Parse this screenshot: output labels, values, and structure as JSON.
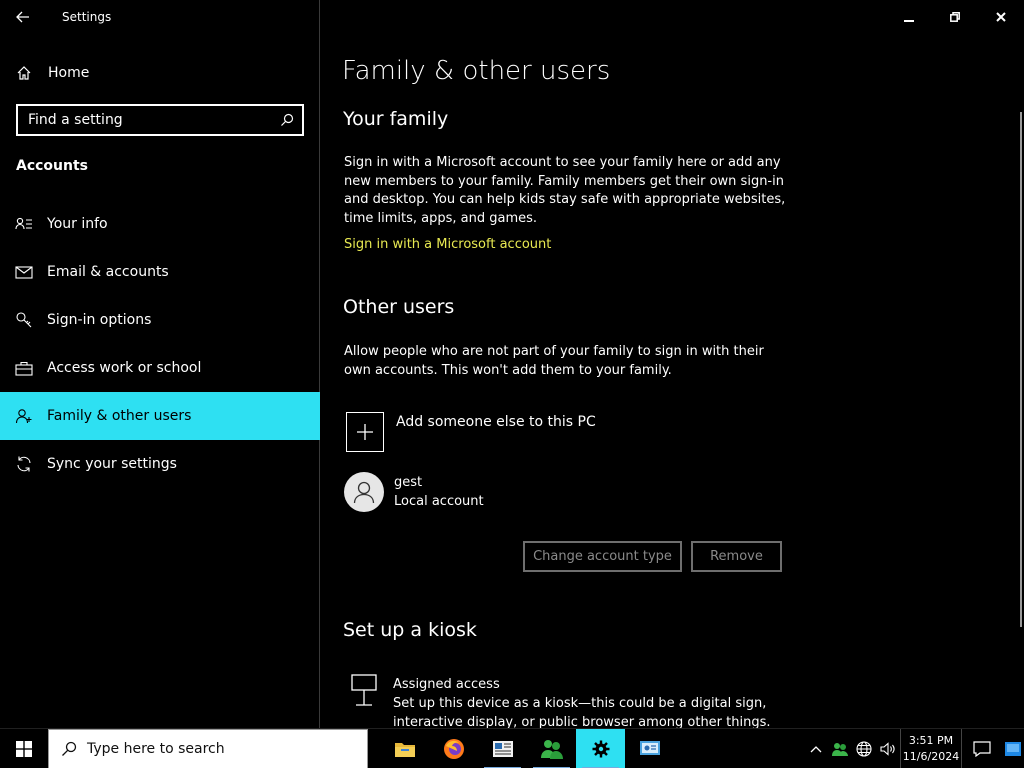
{
  "window": {
    "title": "Settings"
  },
  "sidebar": {
    "home_label": "Home",
    "search_placeholder": "Find a setting",
    "section_label": "Accounts",
    "items": [
      {
        "label": "Your info",
        "icon": "person-list-icon"
      },
      {
        "label": "Email & accounts",
        "icon": "mail-icon"
      },
      {
        "label": "Sign-in options",
        "icon": "key-icon"
      },
      {
        "label": "Access work or school",
        "icon": "briefcase-icon"
      },
      {
        "label": "Family & other users",
        "icon": "person-add-icon",
        "selected": true
      },
      {
        "label": "Sync your settings",
        "icon": "sync-icon"
      }
    ]
  },
  "main": {
    "page_title": "Family & other users",
    "family": {
      "heading": "Your family",
      "description": "Sign in with a Microsoft account to see your family here or add any new members to your family. Family members get their own sign-in and desktop. You can help kids stay safe with appropriate websites, time limits, apps, and games.",
      "link": "Sign in with a Microsoft account"
    },
    "other_users": {
      "heading": "Other users",
      "description": "Allow people who are not part of your family to sign in with their own accounts. This won't add them to your family.",
      "add_label": "Add someone else to this PC",
      "user": {
        "name": "gest",
        "type": "Local account"
      },
      "change_type_button": "Change account type",
      "remove_button": "Remove"
    },
    "kiosk": {
      "heading": "Set up a kiosk",
      "title": "Assigned access",
      "description": "Set up this device as a kiosk—this could be a digital sign, interactive display, or public browser among other things."
    }
  },
  "taskbar": {
    "search_placeholder": "Type here to search",
    "apps": [
      {
        "name": "file-explorer-icon",
        "running": false
      },
      {
        "name": "firefox-icon",
        "running": false
      },
      {
        "name": "news-app-icon",
        "running": true
      },
      {
        "name": "green-people-app-icon",
        "running": true
      },
      {
        "name": "settings-gear-icon",
        "running": true,
        "active": true
      },
      {
        "name": "control-panel-icon",
        "running": false
      }
    ],
    "clock_time": "3:51 PM",
    "clock_date": "11/6/2024"
  },
  "colors": {
    "accent": "#2ee0f2",
    "link": "#e9ea52",
    "background": "#000000"
  }
}
